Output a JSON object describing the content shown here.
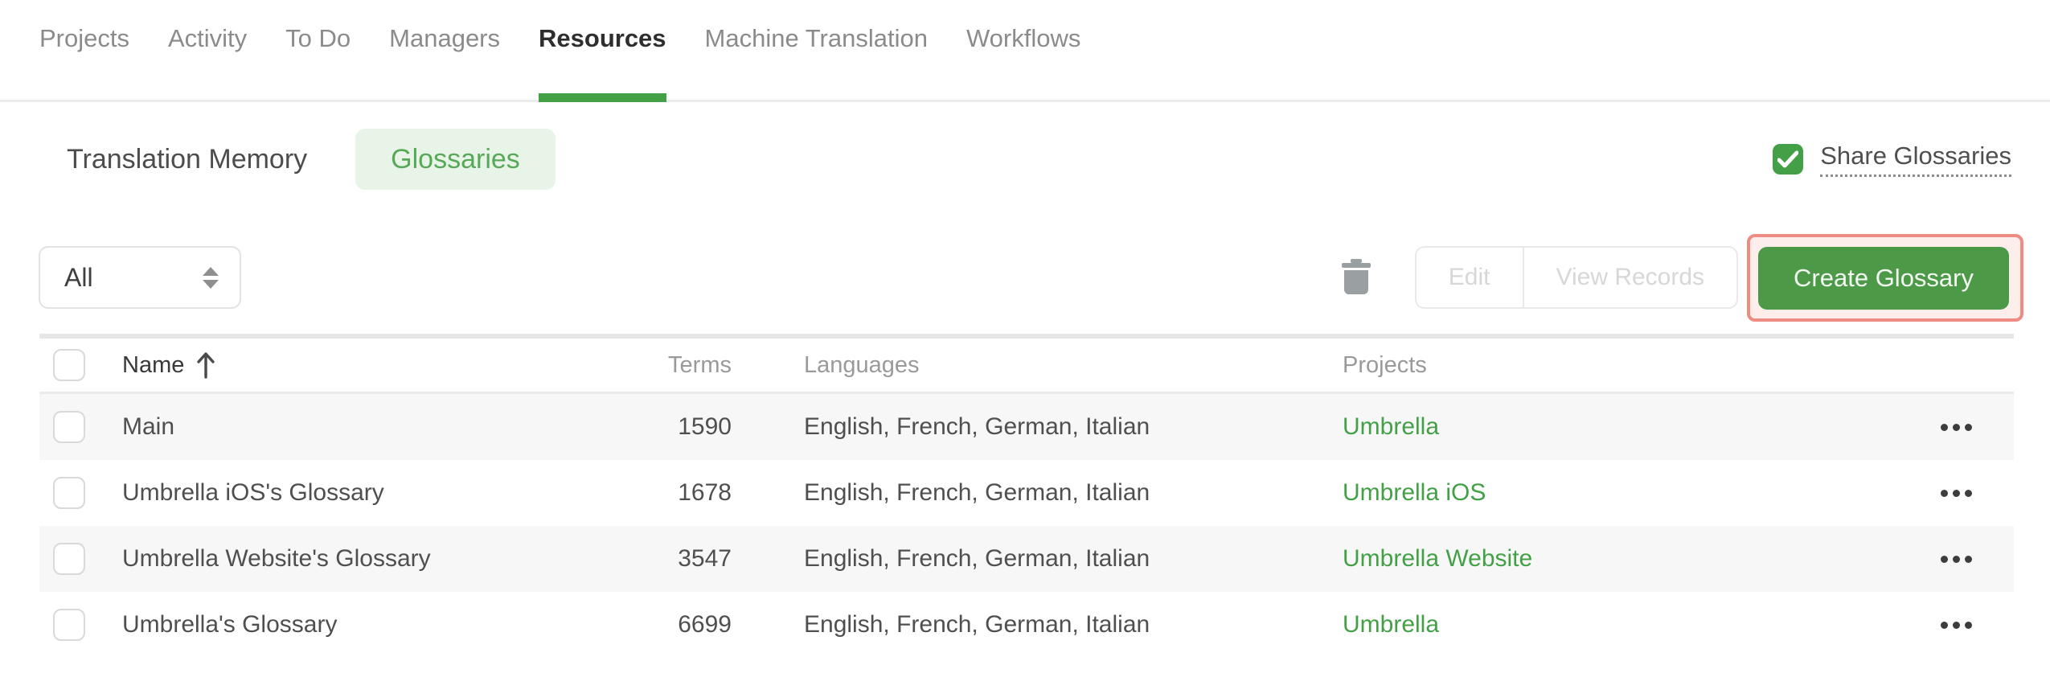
{
  "nav": {
    "tabs": [
      {
        "label": "Projects",
        "active": false
      },
      {
        "label": "Activity",
        "active": false
      },
      {
        "label": "To Do",
        "active": false
      },
      {
        "label": "Managers",
        "active": false
      },
      {
        "label": "Resources",
        "active": true
      },
      {
        "label": "Machine Translation",
        "active": false
      },
      {
        "label": "Workflows",
        "active": false
      }
    ]
  },
  "subnav": {
    "translation_memory_label": "Translation Memory",
    "glossaries_label": "Glossaries",
    "active_tab": "Glossaries",
    "share_glossaries": {
      "label": "Share Glossaries",
      "checked": true
    }
  },
  "toolbar": {
    "filter_value": "All",
    "edit_label": "Edit",
    "view_records_label": "View Records",
    "create_glossary_label": "Create Glossary"
  },
  "table": {
    "columns": {
      "name": "Name",
      "terms": "Terms",
      "languages": "Languages",
      "projects": "Projects"
    },
    "sort": {
      "column": "Name",
      "direction": "ascending"
    },
    "rows": [
      {
        "name": "Main",
        "terms": "1590",
        "languages": "English, French, German, Italian",
        "project": "Umbrella"
      },
      {
        "name": "Umbrella iOS's Glossary",
        "terms": "1678",
        "languages": "English, French, German, Italian",
        "project": "Umbrella iOS"
      },
      {
        "name": "Umbrella Website's Glossary",
        "terms": "3547",
        "languages": "English, French, German, Italian",
        "project": "Umbrella Website"
      },
      {
        "name": "Umbrella's Glossary",
        "terms": "6699",
        "languages": "English, French, German, Italian",
        "project": "Umbrella"
      }
    ]
  },
  "colors": {
    "accent_green": "#43a047",
    "button_green": "#4c9a48",
    "glossaries_pill_bg": "#e9f4e9",
    "glossaries_pill_text": "#57a957",
    "highlight_border": "#ee8b82",
    "highlight_bg": "#fdeeec",
    "row_alt_bg": "#f7f7f7",
    "link_green": "#43a047",
    "inactive_tab": "#8b8b8b",
    "disabled_text": "#d7d7d7"
  }
}
